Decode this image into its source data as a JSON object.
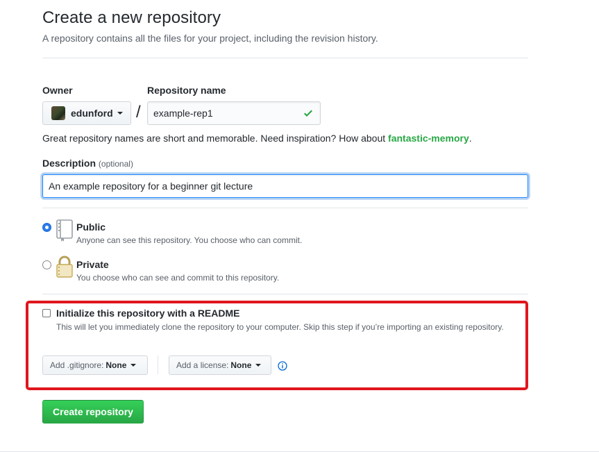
{
  "page": {
    "title": "Create a new repository",
    "subtitle": "A repository contains all the files for your project, including the revision history."
  },
  "owner": {
    "label": "Owner",
    "value": "edunford"
  },
  "repo_name": {
    "label": "Repository name",
    "separator": "/",
    "value": "example-rep1",
    "valid": true
  },
  "name_hint": {
    "text": "Great repository names are short and memorable. Need inspiration? How about ",
    "suggestion": "fantastic-memory",
    "suffix": "."
  },
  "description": {
    "label": "Description",
    "optional_label": "(optional)",
    "value": "An example repository for a beginner git lecture"
  },
  "visibility": {
    "selected": "public",
    "options": [
      {
        "title": "Public",
        "description": "Anyone can see this repository. You choose who can commit.",
        "icon": "repo-icon"
      },
      {
        "title": "Private",
        "description": "You choose who can see and commit to this repository.",
        "icon": "lock-icon"
      }
    ]
  },
  "init": {
    "checked": false,
    "title": "Initialize this repository with a README",
    "description": "This will let you immediately clone the repository to your computer. Skip this step if you’re importing an existing repository."
  },
  "gitignore": {
    "label": "Add .gitignore:",
    "value": "None"
  },
  "license": {
    "label": "Add a license:",
    "value": "None"
  },
  "submit": {
    "label": "Create repository"
  },
  "colors": {
    "accent_blue": "#2b7de9",
    "success_green": "#28a745",
    "highlight_red": "#e0161e"
  }
}
